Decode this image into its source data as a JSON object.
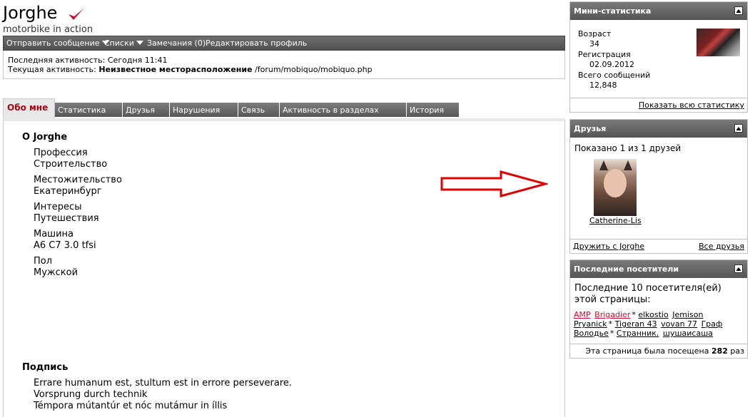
{
  "profile": {
    "username": "Jorghe",
    "usertitle": "motorbike in action"
  },
  "actions": {
    "send_message": "Отправить сообщение",
    "lists": "Списки",
    "notes": "Замечания (0)",
    "edit_profile": "Редактировать профиль"
  },
  "activity": {
    "last_label": "Последняя активность:",
    "last_value": "Сегодня 11:41",
    "current_label": "Текущая активность:",
    "current_bold": "Неизвестное месторасположение",
    "current_path": "/forum/mobiquo/mobiquo.php"
  },
  "tabs": [
    "Обо мне",
    "Статистика",
    "Друзья",
    "Нарушения",
    "Связь",
    "Активность в разделах",
    "История"
  ],
  "about": {
    "title": "О Jorghe",
    "fields": [
      {
        "label": "Профессия",
        "value": "Строительство"
      },
      {
        "label": "Местожительство",
        "value": "Екатеринбург"
      },
      {
        "label": "Интересы",
        "value": "Путешествия"
      },
      {
        "label": "Машина",
        "value": "A6 C7 3.0 tfsi"
      },
      {
        "label": "Пол",
        "value": "Мужской"
      }
    ]
  },
  "signature": {
    "title": "Подпись",
    "lines": [
      "Errare humanum est, stultum est in errore perseverare.",
      "Vorsprung durch technik",
      "Témpora mútantúr et nóc mutámur in íllis"
    ]
  },
  "ministats": {
    "title": "Мини-статистика",
    "age_label": "Возраст",
    "age_value": "34",
    "reg_label": "Регистрация",
    "reg_value": "02.09.2012",
    "posts_label": "Всего сообщений",
    "posts_value": "12,848",
    "show_all": "Показать всю статистику"
  },
  "friends": {
    "title": "Друзья",
    "shown": "Показано 1 из 1 друзей",
    "friend_name": "Catherine-Lis",
    "befriend": "Дружить с Jorghe",
    "all_friends": "Все друзья"
  },
  "visitors": {
    "title": "Последние посетители",
    "intro_line1": "Последние 10 посетителя(ей)",
    "intro_line2": "этой страницы:",
    "names": [
      {
        "name": "AMP",
        "red": true,
        "star": false
      },
      {
        "name": "Brigadier",
        "red": true,
        "star": true
      },
      {
        "name": "elkostio",
        "red": false,
        "star": false
      },
      {
        "name": "Jemison",
        "red": false,
        "star": false
      },
      {
        "name": "Pryanick",
        "red": false,
        "star": true
      },
      {
        "name": "Tigeran 43",
        "red": false,
        "star": false
      },
      {
        "name": "vovan 77",
        "red": false,
        "star": false
      },
      {
        "name": "Граф",
        "red": false,
        "star": false
      },
      {
        "name": "Володье",
        "red": false,
        "star": true
      },
      {
        "name": "Странник.",
        "red": false,
        "star": false
      },
      {
        "name": "шушаисаша",
        "red": false,
        "star": false
      }
    ],
    "visited_text": "Эта страница была посещена",
    "visited_count": "282",
    "visited_suffix": "раз"
  },
  "colors": {
    "accent_red": "#c8102e",
    "header_gray": "#5a5a5a"
  }
}
